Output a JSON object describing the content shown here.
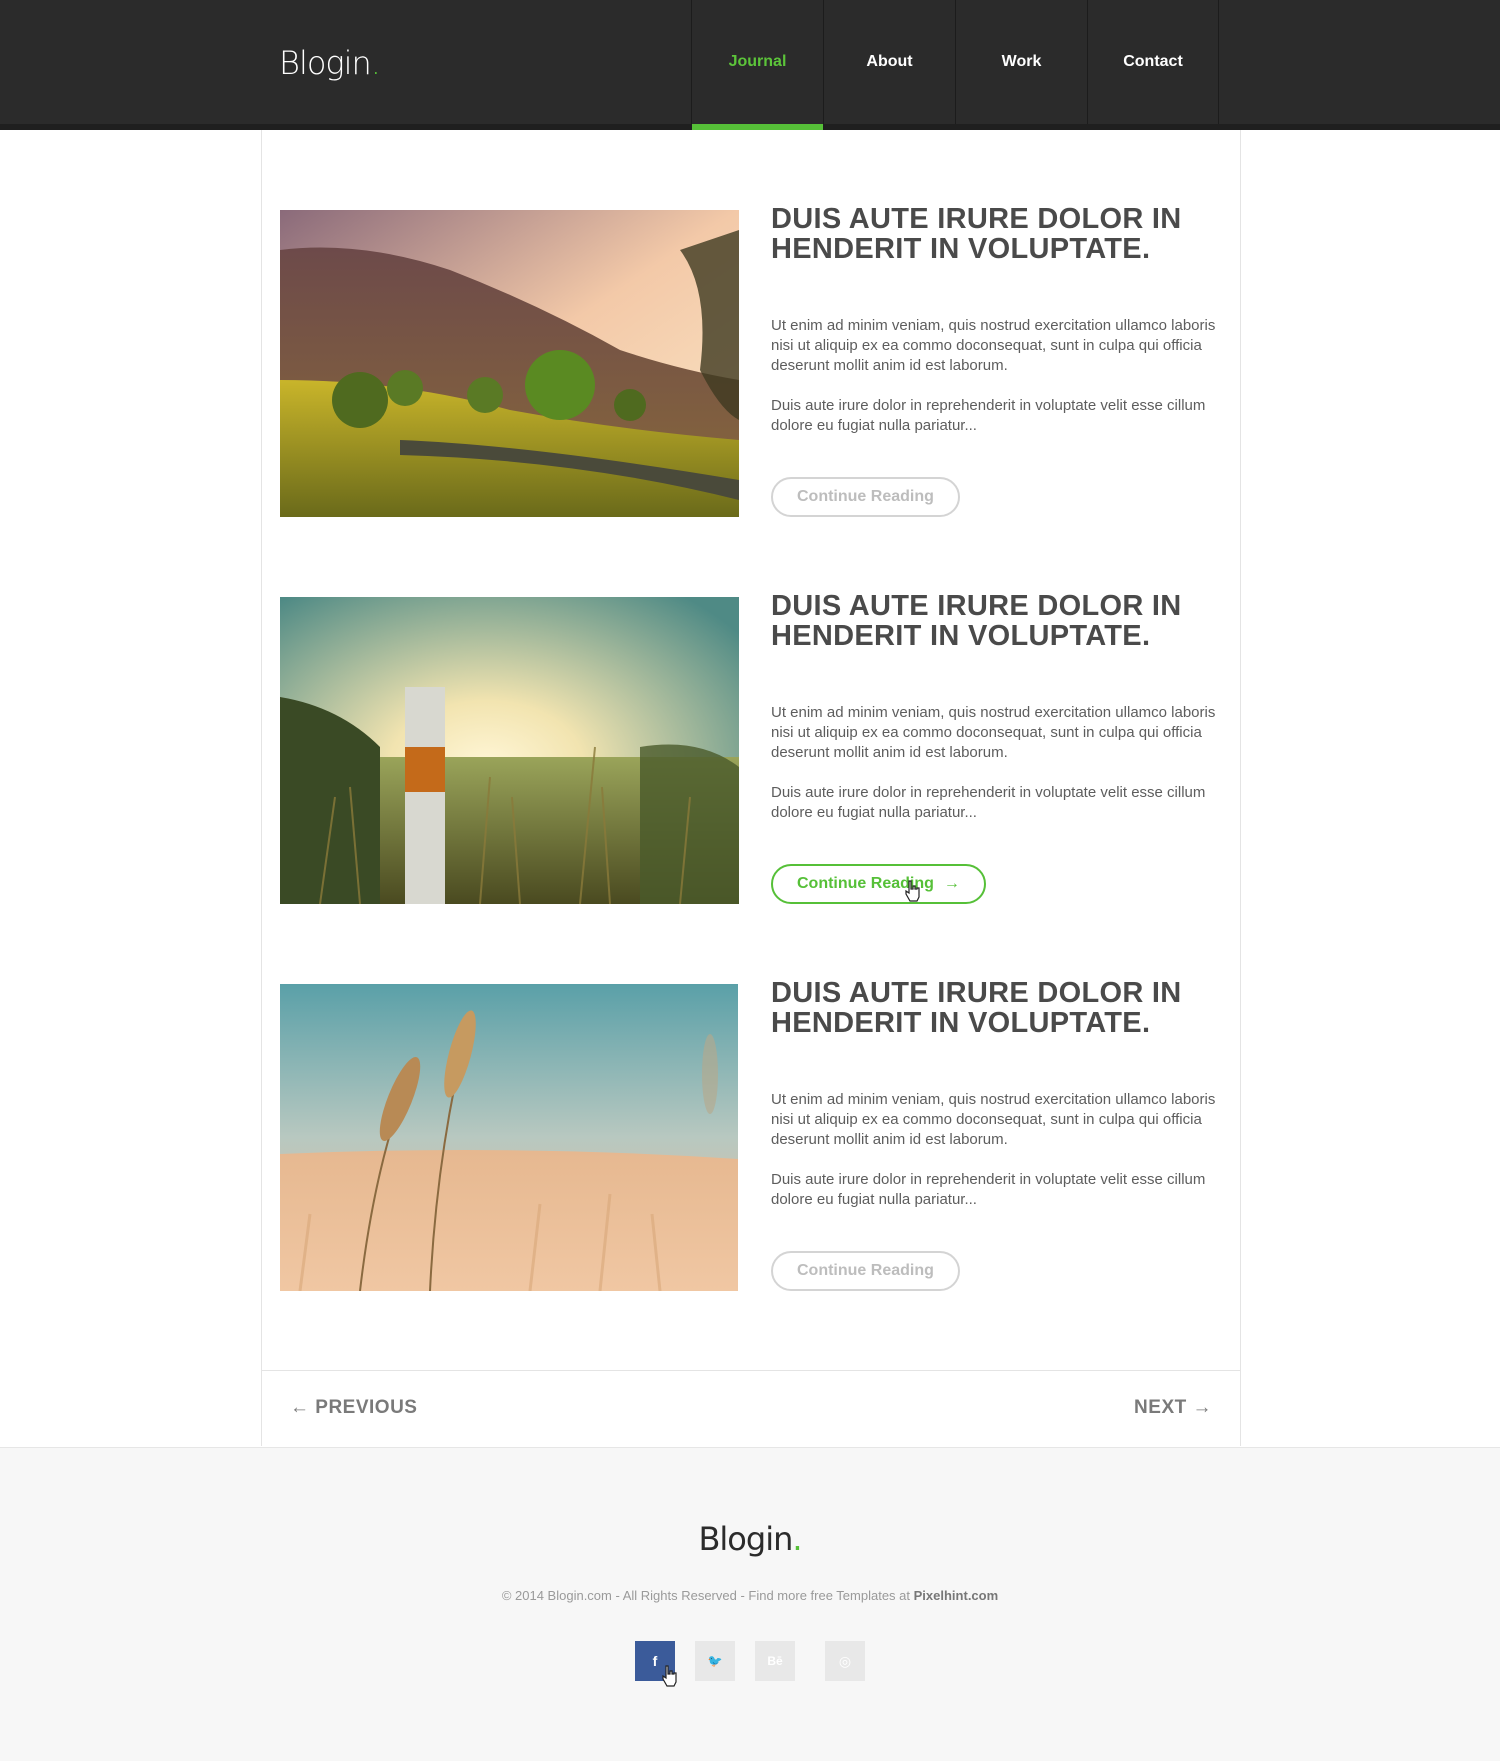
{
  "header": {
    "logo": "Blogin",
    "logo_dot": ".",
    "nav": [
      {
        "label": "Journal",
        "active": true
      },
      {
        "label": "About",
        "active": false
      },
      {
        "label": "Work",
        "active": false
      },
      {
        "label": "Contact",
        "active": false
      }
    ]
  },
  "posts": [
    {
      "title": "DUIS AUTE IRURE DOLOR IN HENDERIT IN VOLUPTATE.",
      "p1": "Ut enim ad minim veniam, quis nostrud exercitation ullamco laboris nisi ut aliquip ex ea commo doconsequat, sunt in culpa qui officia deserunt mollit anim id est laborum.",
      "p2": "Duis aute irure dolor in reprehenderit in voluptate velit esse cillum dolore eu fugiat nulla pariatur...",
      "button": "Continue Reading",
      "image": "hillside-landscape-photo"
    },
    {
      "title": "DUIS AUTE IRURE DOLOR IN HENDERIT IN VOLUPTATE.",
      "p1": "Ut enim ad minim veniam, quis nostrud exercitation ullamco laboris nisi ut aliquip ex ea commo doconsequat, sunt in culpa qui officia deserunt mollit anim id est laborum.",
      "p2": "Duis aute irure dolor in reprehenderit in voluptate velit esse cillum dolore eu fugiat nulla pariatur...",
      "button": "Continue Reading",
      "button_arrow": "→",
      "image": "sunset-grass-post-photo"
    },
    {
      "title": "DUIS AUTE IRURE DOLOR IN HENDERIT IN VOLUPTATE.",
      "p1": "Ut enim ad minim veniam, quis nostrud exercitation ullamco laboris nisi ut aliquip ex ea commo doconsequat, sunt in culpa qui officia deserunt mollit anim id est laborum.",
      "p2": "Duis aute irure dolor in reprehenderit in voluptate velit esse cillum dolore eu fugiat nulla pariatur...",
      "button": "Continue Reading",
      "image": "wheat-field-photo"
    }
  ],
  "pager": {
    "prev": "← PREVIOUS",
    "next": "NEXT →"
  },
  "footer": {
    "logo": "Blogin",
    "logo_dot": ".",
    "copyright": "© 2014 Blogin.com  -  All Rights Reserved  -  Find more free Templates at",
    "link": "Pixelhint.com",
    "socials": [
      {
        "icon": "facebook-icon",
        "glyph": "f"
      },
      {
        "icon": "twitter-icon",
        "glyph": "🐦"
      },
      {
        "icon": "behance-icon",
        "glyph": "Bē"
      },
      {
        "icon": "dribbble-icon",
        "glyph": "◎"
      }
    ]
  },
  "colors": {
    "accent": "#56c038",
    "header_bg": "#2b2b2b",
    "facebook": "#3b5b9a"
  }
}
